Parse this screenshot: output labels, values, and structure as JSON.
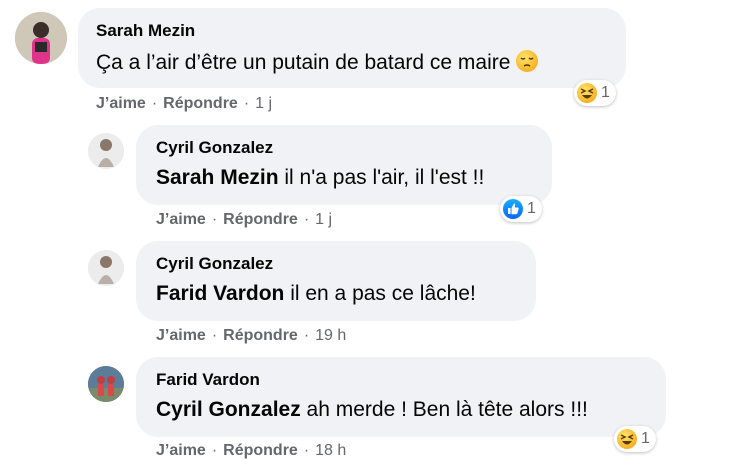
{
  "comments": [
    {
      "author": "Sarah Mezin",
      "mention": "",
      "text": "Ça a l’air d’être un putain de batard ce maire",
      "like_label": "J’aime",
      "reply_label": "Répondre",
      "time": "1 j",
      "reaction_count": "1",
      "reaction_icon": "haha-icon",
      "inline_emoji": "pensive-face-icon"
    },
    {
      "author": "Cyril Gonzalez",
      "mention": "Sarah Mezin",
      "text": "il n'a pas l'air, il l'est !!",
      "like_label": "J’aime",
      "reply_label": "Répondre",
      "time": "1 j",
      "reaction_count": "1",
      "reaction_icon": "like-icon"
    },
    {
      "author": "Cyril Gonzalez",
      "mention": "Farid Vardon",
      "text": "il en a pas ce lâche!",
      "like_label": "J’aime",
      "reply_label": "Répondre",
      "time": "19 h"
    },
    {
      "author": "Farid Vardon",
      "mention": "Cyril Gonzalez",
      "text": "ah merde ! Ben là tête alors !!!",
      "like_label": "J’aime",
      "reply_label": "Répondre",
      "time": "18 h",
      "reaction_count": "1",
      "reaction_icon": "haha-icon"
    }
  ],
  "separator": "·",
  "colors": {
    "bubble": "#f0f2f5",
    "meta_text": "#65676b",
    "like_blue": "#0866ff",
    "haha_yellow": "#f7b125"
  }
}
